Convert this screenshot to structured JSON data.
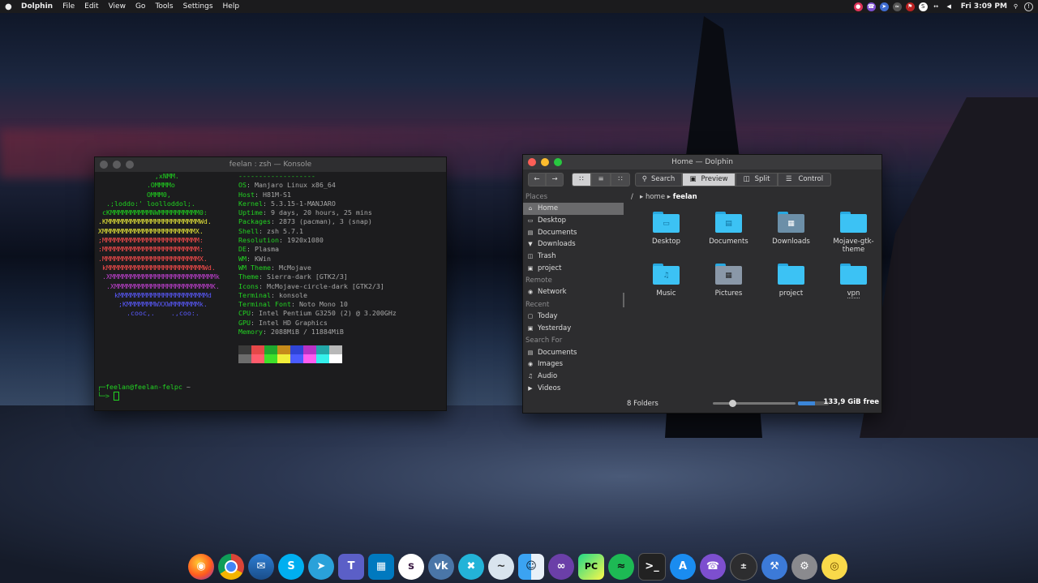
{
  "menubar": {
    "apple_icon": "apple-icon",
    "app_name": "Dolphin",
    "items": [
      "File",
      "Edit",
      "View",
      "Go",
      "Tools",
      "Settings",
      "Help"
    ],
    "clock": "Fri 3:09 PM"
  },
  "konsole": {
    "title": "feelan : zsh — Konsole",
    "ascii": [
      "              ,xNMM.",
      "            .OMMMMo",
      "            OMMM0,",
      "  .;loddo:' loolloddol;.",
      " cKMMMMMMMMMMNWMMMMMMMMMM0:",
      ".KMMMMMMMMMMMMMMMMMMMMMMMWd.",
      "XMMMMMMMMMMMMMMMMMMMMMMMX.",
      ";MMMMMMMMMMMMMMMMMMMMMMMM:",
      ":MMMMMMMMMMMMMMMMMMMMMMMM:",
      ".MMMMMMMMMMMMMMMMMMMMMMMMX.",
      " kMMMMMMMMMMMMMMMMMMMMMMMMWd.",
      " .XMMMMMMMMMMMMMMMMMMMMMMMMMMk",
      "  .XMMMMMMMMMMMMMMMMMMMMMMMMK.",
      "    kMMMMMMMMMMMMMMMMMMMMMMd",
      "     ;KMMMMMMMWXXWMMMMMMMk.",
      "       .cooc,.    .,coo:."
    ],
    "separator": "-------------------",
    "info": [
      {
        "k": "OS",
        "v": "Manjaro Linux x86_64"
      },
      {
        "k": "Host",
        "v": "H81M-S1"
      },
      {
        "k": "Kernel",
        "v": "5.3.15-1-MANJARO"
      },
      {
        "k": "Uptime",
        "v": "9 days, 20 hours, 25 mins"
      },
      {
        "k": "Packages",
        "v": "2873 (pacman), 3 (snap)"
      },
      {
        "k": "Shell",
        "v": "zsh 5.7.1"
      },
      {
        "k": "Resolution",
        "v": "1920x1080"
      },
      {
        "k": "DE",
        "v": "Plasma"
      },
      {
        "k": "WM",
        "v": "KWin"
      },
      {
        "k": "WM Theme",
        "v": "McMojave"
      },
      {
        "k": "Theme",
        "v": "Sierra-dark [GTK2/3]"
      },
      {
        "k": "Icons",
        "v": "McMojave-circle-dark [GTK2/3]"
      },
      {
        "k": "Terminal",
        "v": "konsole"
      },
      {
        "k": "Terminal Font",
        "v": "Noto Mono 10"
      },
      {
        "k": "CPU",
        "v": "Intel Pentium G3250 (2) @ 3.200GHz"
      },
      {
        "k": "GPU",
        "v": "Intel HD Graphics"
      },
      {
        "k": "Memory",
        "v": "2088MiB / 11884MiB"
      }
    ],
    "palette": [
      "#3a3a3a",
      "#e54848",
      "#1fa82e",
      "#c58a1a",
      "#2f44d6",
      "#b832c6",
      "#22a6a8",
      "#b8b8b8",
      "#6c6c6c",
      "#ff5c6c",
      "#3ee02a",
      "#f1ee3a",
      "#4a5cff",
      "#ff5cf0",
      "#35f0ec",
      "#ffffff"
    ],
    "prompt_user": "feelan@feelan-felpc",
    "prompt_dir": "~"
  },
  "dolphin": {
    "title": "Home — Dolphin",
    "toolbar": {
      "search": "Search",
      "preview": "Preview",
      "split": "Split",
      "control": "Control"
    },
    "sidebar": {
      "places_head": "Places",
      "places": [
        "Home",
        "Desktop",
        "Documents",
        "Downloads",
        "Trash",
        "project"
      ],
      "remote_head": "Remote",
      "remote": [
        "Network"
      ],
      "recent_head": "Recent",
      "recent": [
        "Today",
        "Yesterday"
      ],
      "search_head": "Search For",
      "search": [
        "Documents",
        "Images",
        "Audio",
        "Videos"
      ]
    },
    "breadcrumb": {
      "root": "/",
      "home": "home",
      "current": "feelan"
    },
    "files": [
      "Desktop",
      "Documents",
      "Downloads",
      "Mojave-gtk-theme",
      "Music",
      "Pictures",
      "project",
      "vpn"
    ],
    "status_text": "8 Folders",
    "zoom_fraction": 0.22,
    "used_fraction": 0.55,
    "free_space": "133,9 GiB free"
  },
  "dock": {
    "apps": [
      "firefox-icon",
      "chrome-icon",
      "thunderbird-icon",
      "skype-icon",
      "telegram-icon",
      "teams-icon",
      "trello-icon",
      "slack-icon",
      "vk-icon",
      "xcode-icon",
      "mustache-icon",
      "finder-icon",
      "visual-studio-icon",
      "pycharm-eap-icon",
      "spotify-icon",
      "terminal-icon",
      "app-store-icon",
      "viber-icon",
      "calculator-icon",
      "utilities-icon",
      "system-preferences-icon",
      "lightbulb-icon"
    ]
  }
}
